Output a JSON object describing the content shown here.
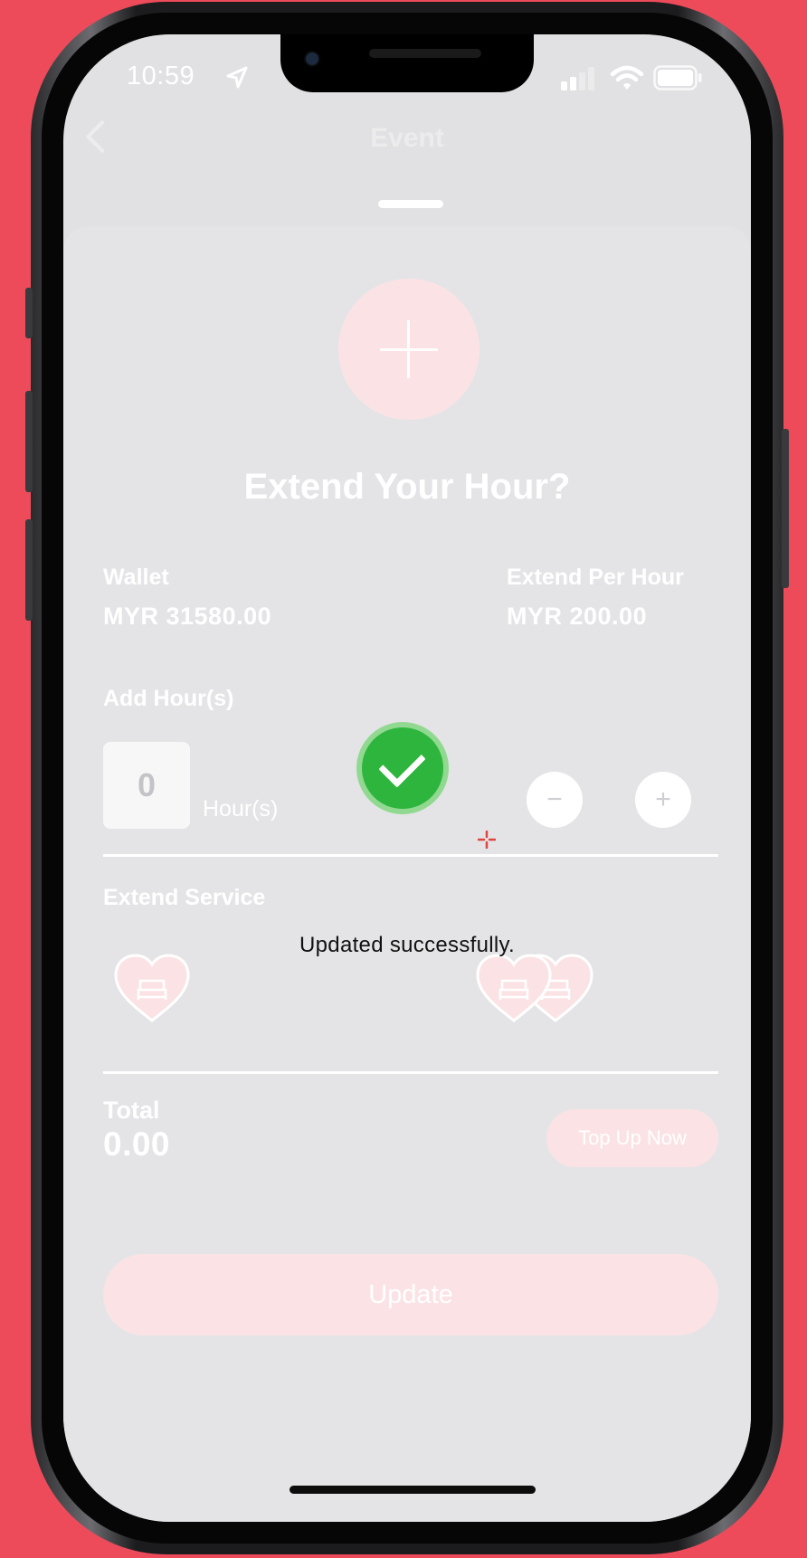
{
  "status_bar": {
    "time": "10:59"
  },
  "nav": {
    "title": "Event"
  },
  "sheet": {
    "title": "Extend Your Hour?",
    "wallet": {
      "label": "Wallet",
      "value": "MYR 31580.00"
    },
    "rate": {
      "label": "Extend Per Hour",
      "value": "MYR 200.00"
    },
    "hours": {
      "label": "Add Hour(s)",
      "value": "0",
      "unit": "Hour(s)",
      "decrement": "−",
      "increment": "+"
    },
    "service": {
      "label": "Extend Service"
    },
    "total": {
      "label": "Total",
      "value": "0.00"
    },
    "top_up_label": "Top Up Now",
    "update_label": "Update"
  },
  "toast": {
    "message": "Updated successfully."
  },
  "colors": {
    "background": "#ee4b5a",
    "accent_pink": "#fbe3e5",
    "success_green": "#2eb53d"
  }
}
